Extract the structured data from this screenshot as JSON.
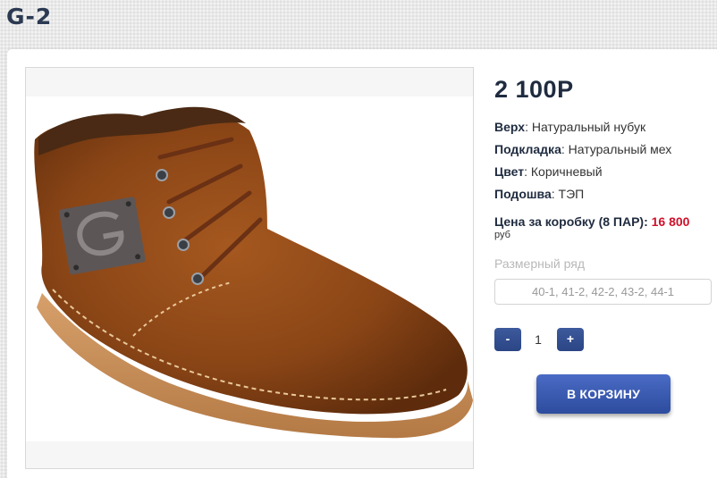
{
  "page": {
    "title": "G-2"
  },
  "product": {
    "price": "2 100Р",
    "specs": [
      {
        "label": "Верх",
        "value": ": Натуральный нубук"
      },
      {
        "label": "Подкладка",
        "value": ": Натуральный мех"
      },
      {
        "label": "Цвет",
        "value": ": Коричневый"
      },
      {
        "label": "Подошва",
        "value": ": ТЭП"
      }
    ],
    "box_price": {
      "label": "Цена за коробку (8 ПАР): ",
      "value": "16 800",
      "unit": "руб"
    },
    "sizes": {
      "label": "Размерный ряд",
      "value": "40-1, 41-2, 42-2, 43-2, 44-1"
    },
    "quantity": {
      "minus": "-",
      "value": "1",
      "plus": "+"
    },
    "cart_button": "В КОРЗИНУ",
    "image": {
      "description_icon": "brown-suede-boot-photo"
    }
  },
  "colors": {
    "accent_blue": "#2d4c9e",
    "price_red": "#d0102a",
    "title_navy": "#1f2b3f"
  }
}
